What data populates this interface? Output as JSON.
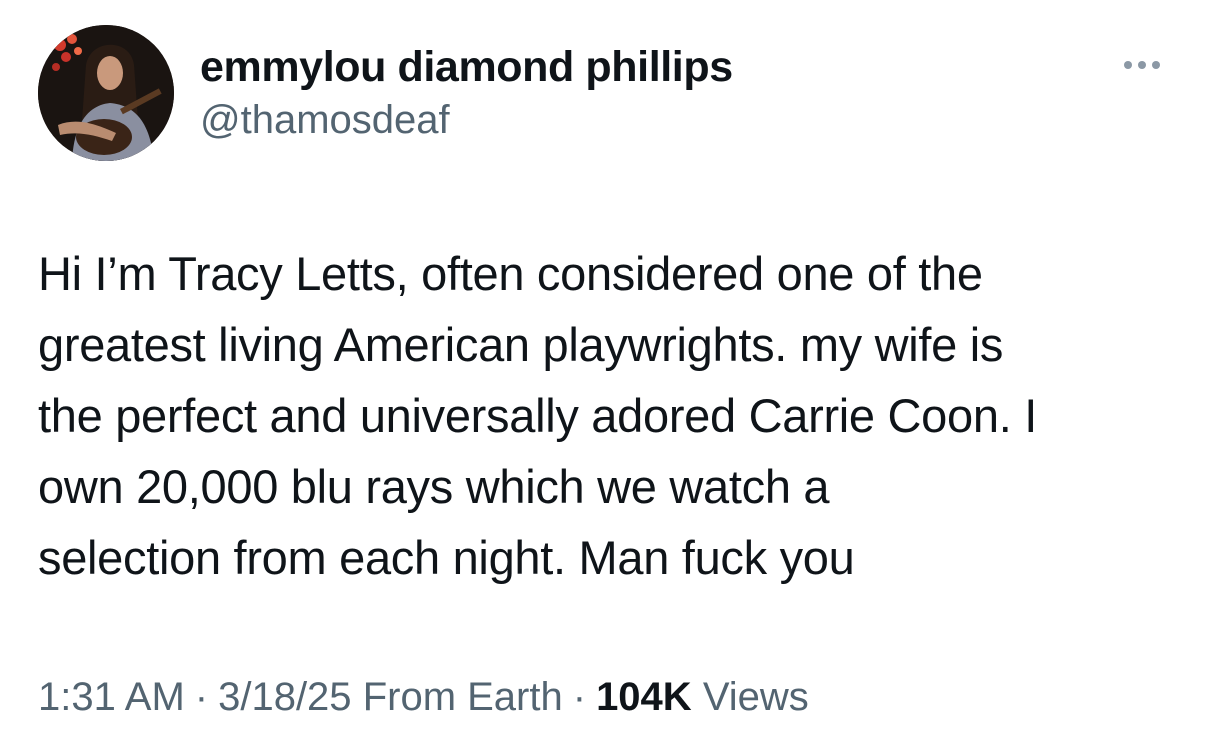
{
  "author": {
    "display_name": "emmylou diamond phillips",
    "handle": "@thamosdeaf",
    "avatar_icon": "profile-photo-guitarist"
  },
  "more_icon": "ellipsis-icon",
  "tweet": {
    "lines": [
      "Hi I’m Tracy Letts, often considered one of the",
      "greatest living American playwrights. my wife is",
      "the perfect and universally adored Carrie Coon. I",
      "own 20,000 blu rays which we watch a",
      "selection from each night. Man fuck you"
    ]
  },
  "meta": {
    "time": "1:31 AM",
    "separator": "·",
    "date": "3/18/25",
    "source": "From Earth",
    "views_count": "104K",
    "views_label": "Views"
  },
  "colors": {
    "text_primary": "#0f1419",
    "text_secondary": "#536471",
    "background": "#ffffff"
  }
}
